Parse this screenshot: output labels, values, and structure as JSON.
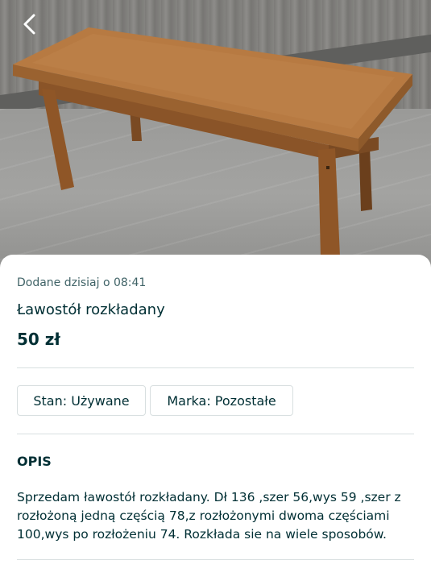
{
  "listing": {
    "posted": "Dodane dzisiaj o 08:41",
    "title": "Ławostół rozkładany",
    "price": "50 zł"
  },
  "params": [
    {
      "label": "Stan: Używane"
    },
    {
      "label": "Marka: Pozostałe"
    }
  ],
  "description": {
    "heading": "OPIS",
    "text": "Sprzedam ławostół rozkładany. Dł 136 ,szer 56,wys 59 ,szer z rozłożoną jedną częścią 78,z rozłożonymi dwoma częściami 100,wys po rozłożeniu 74. Rozkłada sie na wiele sposobów."
  },
  "icons": {
    "back": "chevron-left-icon"
  },
  "colors": {
    "text_primary": "#002f34",
    "text_secondary": "#406367",
    "divider": "#d8dfe0"
  }
}
